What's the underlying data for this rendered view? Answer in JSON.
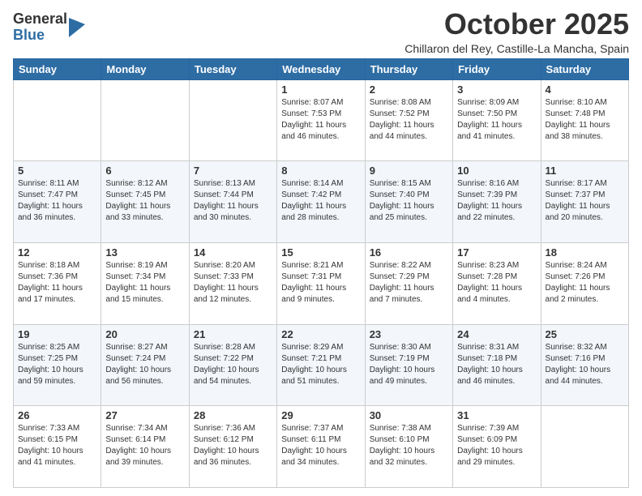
{
  "logo": {
    "general": "General",
    "blue": "Blue"
  },
  "header": {
    "month": "October 2025",
    "location": "Chillaron del Rey, Castille-La Mancha, Spain"
  },
  "days_of_week": [
    "Sunday",
    "Monday",
    "Tuesday",
    "Wednesday",
    "Thursday",
    "Friday",
    "Saturday"
  ],
  "weeks": [
    [
      {
        "day": null
      },
      {
        "day": null
      },
      {
        "day": null
      },
      {
        "day": "1",
        "sunrise": "Sunrise: 8:07 AM",
        "sunset": "Sunset: 7:53 PM",
        "daylight": "Daylight: 11 hours and 46 minutes."
      },
      {
        "day": "2",
        "sunrise": "Sunrise: 8:08 AM",
        "sunset": "Sunset: 7:52 PM",
        "daylight": "Daylight: 11 hours and 44 minutes."
      },
      {
        "day": "3",
        "sunrise": "Sunrise: 8:09 AM",
        "sunset": "Sunset: 7:50 PM",
        "daylight": "Daylight: 11 hours and 41 minutes."
      },
      {
        "day": "4",
        "sunrise": "Sunrise: 8:10 AM",
        "sunset": "Sunset: 7:48 PM",
        "daylight": "Daylight: 11 hours and 38 minutes."
      }
    ],
    [
      {
        "day": "5",
        "sunrise": "Sunrise: 8:11 AM",
        "sunset": "Sunset: 7:47 PM",
        "daylight": "Daylight: 11 hours and 36 minutes."
      },
      {
        "day": "6",
        "sunrise": "Sunrise: 8:12 AM",
        "sunset": "Sunset: 7:45 PM",
        "daylight": "Daylight: 11 hours and 33 minutes."
      },
      {
        "day": "7",
        "sunrise": "Sunrise: 8:13 AM",
        "sunset": "Sunset: 7:44 PM",
        "daylight": "Daylight: 11 hours and 30 minutes."
      },
      {
        "day": "8",
        "sunrise": "Sunrise: 8:14 AM",
        "sunset": "Sunset: 7:42 PM",
        "daylight": "Daylight: 11 hours and 28 minutes."
      },
      {
        "day": "9",
        "sunrise": "Sunrise: 8:15 AM",
        "sunset": "Sunset: 7:40 PM",
        "daylight": "Daylight: 11 hours and 25 minutes."
      },
      {
        "day": "10",
        "sunrise": "Sunrise: 8:16 AM",
        "sunset": "Sunset: 7:39 PM",
        "daylight": "Daylight: 11 hours and 22 minutes."
      },
      {
        "day": "11",
        "sunrise": "Sunrise: 8:17 AM",
        "sunset": "Sunset: 7:37 PM",
        "daylight": "Daylight: 11 hours and 20 minutes."
      }
    ],
    [
      {
        "day": "12",
        "sunrise": "Sunrise: 8:18 AM",
        "sunset": "Sunset: 7:36 PM",
        "daylight": "Daylight: 11 hours and 17 minutes."
      },
      {
        "day": "13",
        "sunrise": "Sunrise: 8:19 AM",
        "sunset": "Sunset: 7:34 PM",
        "daylight": "Daylight: 11 hours and 15 minutes."
      },
      {
        "day": "14",
        "sunrise": "Sunrise: 8:20 AM",
        "sunset": "Sunset: 7:33 PM",
        "daylight": "Daylight: 11 hours and 12 minutes."
      },
      {
        "day": "15",
        "sunrise": "Sunrise: 8:21 AM",
        "sunset": "Sunset: 7:31 PM",
        "daylight": "Daylight: 11 hours and 9 minutes."
      },
      {
        "day": "16",
        "sunrise": "Sunrise: 8:22 AM",
        "sunset": "Sunset: 7:29 PM",
        "daylight": "Daylight: 11 hours and 7 minutes."
      },
      {
        "day": "17",
        "sunrise": "Sunrise: 8:23 AM",
        "sunset": "Sunset: 7:28 PM",
        "daylight": "Daylight: 11 hours and 4 minutes."
      },
      {
        "day": "18",
        "sunrise": "Sunrise: 8:24 AM",
        "sunset": "Sunset: 7:26 PM",
        "daylight": "Daylight: 11 hours and 2 minutes."
      }
    ],
    [
      {
        "day": "19",
        "sunrise": "Sunrise: 8:25 AM",
        "sunset": "Sunset: 7:25 PM",
        "daylight": "Daylight: 10 hours and 59 minutes."
      },
      {
        "day": "20",
        "sunrise": "Sunrise: 8:27 AM",
        "sunset": "Sunset: 7:24 PM",
        "daylight": "Daylight: 10 hours and 56 minutes."
      },
      {
        "day": "21",
        "sunrise": "Sunrise: 8:28 AM",
        "sunset": "Sunset: 7:22 PM",
        "daylight": "Daylight: 10 hours and 54 minutes."
      },
      {
        "day": "22",
        "sunrise": "Sunrise: 8:29 AM",
        "sunset": "Sunset: 7:21 PM",
        "daylight": "Daylight: 10 hours and 51 minutes."
      },
      {
        "day": "23",
        "sunrise": "Sunrise: 8:30 AM",
        "sunset": "Sunset: 7:19 PM",
        "daylight": "Daylight: 10 hours and 49 minutes."
      },
      {
        "day": "24",
        "sunrise": "Sunrise: 8:31 AM",
        "sunset": "Sunset: 7:18 PM",
        "daylight": "Daylight: 10 hours and 46 minutes."
      },
      {
        "day": "25",
        "sunrise": "Sunrise: 8:32 AM",
        "sunset": "Sunset: 7:16 PM",
        "daylight": "Daylight: 10 hours and 44 minutes."
      }
    ],
    [
      {
        "day": "26",
        "sunrise": "Sunrise: 7:33 AM",
        "sunset": "Sunset: 6:15 PM",
        "daylight": "Daylight: 10 hours and 41 minutes."
      },
      {
        "day": "27",
        "sunrise": "Sunrise: 7:34 AM",
        "sunset": "Sunset: 6:14 PM",
        "daylight": "Daylight: 10 hours and 39 minutes."
      },
      {
        "day": "28",
        "sunrise": "Sunrise: 7:36 AM",
        "sunset": "Sunset: 6:12 PM",
        "daylight": "Daylight: 10 hours and 36 minutes."
      },
      {
        "day": "29",
        "sunrise": "Sunrise: 7:37 AM",
        "sunset": "Sunset: 6:11 PM",
        "daylight": "Daylight: 10 hours and 34 minutes."
      },
      {
        "day": "30",
        "sunrise": "Sunrise: 7:38 AM",
        "sunset": "Sunset: 6:10 PM",
        "daylight": "Daylight: 10 hours and 32 minutes."
      },
      {
        "day": "31",
        "sunrise": "Sunrise: 7:39 AM",
        "sunset": "Sunset: 6:09 PM",
        "daylight": "Daylight: 10 hours and 29 minutes."
      },
      {
        "day": null
      }
    ]
  ]
}
